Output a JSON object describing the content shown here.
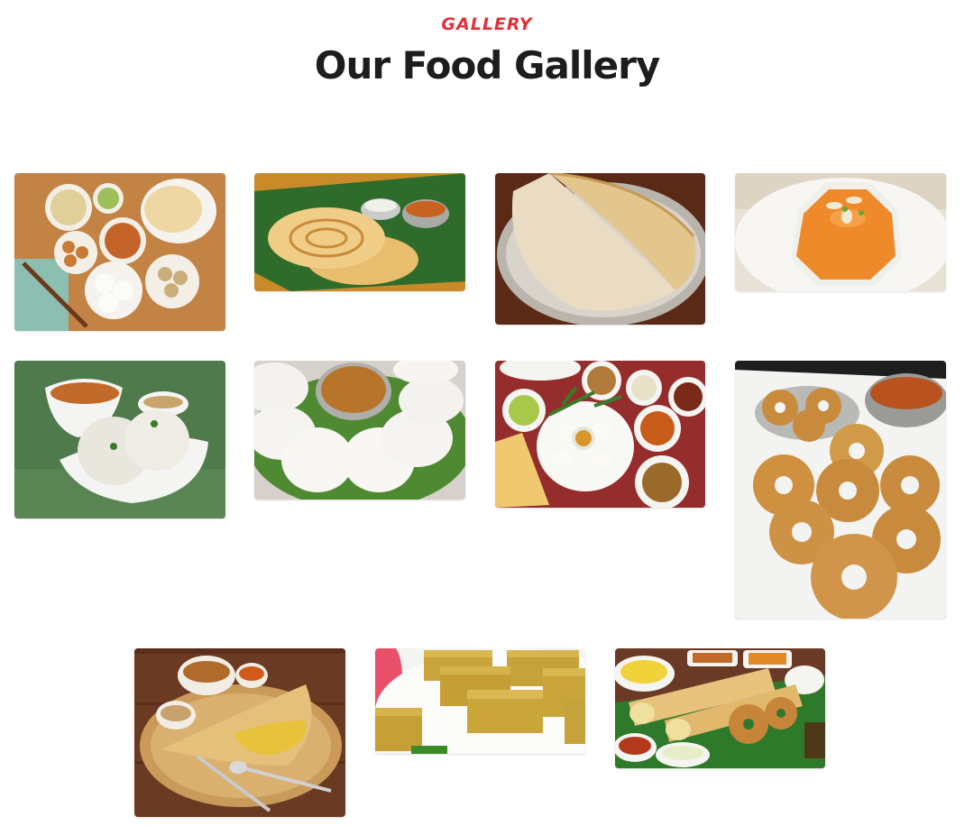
{
  "header": {
    "eyebrow": "GALLERY",
    "title": "Our Food Gallery"
  },
  "colors": {
    "accent": "#e0313a",
    "heading": "#1d1d1f"
  },
  "gallery": {
    "items": [
      {
        "subject": "south-indian-breakfast-platter"
      },
      {
        "subject": "parotta-on-banana-leaf"
      },
      {
        "subject": "plain-dosa"
      },
      {
        "subject": "kesari-halwa"
      },
      {
        "subject": "rava-idli-with-sambar"
      },
      {
        "subject": "idli-with-sambar"
      },
      {
        "subject": "idli-thali"
      },
      {
        "subject": "medu-vada"
      },
      {
        "subject": "masala-dosa-with-chutney"
      },
      {
        "subject": "mysore-pak"
      },
      {
        "subject": "masala-dosa-and-vada"
      }
    ]
  }
}
